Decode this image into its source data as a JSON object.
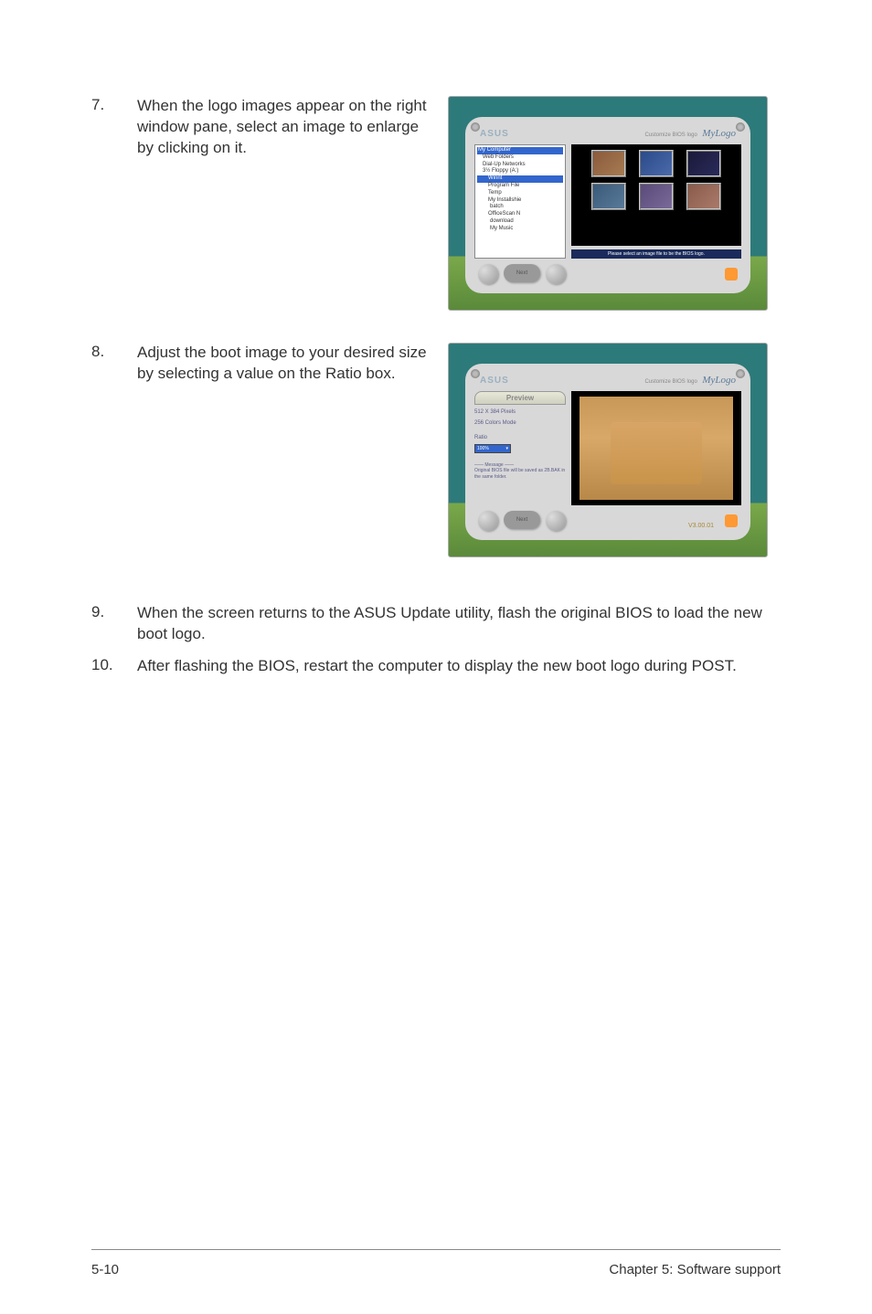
{
  "steps": {
    "s7": {
      "num": "7.",
      "text": "When the logo images appear on the right window pane, select an image to enlarge by clicking on it."
    },
    "s8": {
      "num": "8.",
      "text": "Adjust the boot image to your desired size by selecting a value on the Ratio box."
    },
    "s9": {
      "num": "9.",
      "text": "When the screen returns to the ASUS Update utility, flash the original BIOS to load the new boot logo."
    },
    "s10": {
      "num": "10.",
      "text": "After flashing the BIOS, restart the computer to display the new boot logo during POST."
    }
  },
  "screenshot1": {
    "brand": "ASUS",
    "customize": "Customize BIOS logo",
    "mylogo": "MyLogo",
    "tree": {
      "root": "My Computer",
      "items": [
        "Web Folders",
        "Dial-Up Networks",
        "3½ Floppy (A:)",
        "Winnt",
        "Program File",
        "Temp",
        "My Installshie",
        "batch",
        "OfficeScan N",
        "download",
        "My Music"
      ]
    },
    "status": "Please select an image file to be the BIOS logo.",
    "next_btn": "Next"
  },
  "screenshot2": {
    "brand": "ASUS",
    "customize": "Customize BIOS logo",
    "mylogo": "MyLogo",
    "preview_tab": "Preview",
    "pixels": "512 X 384 Pixels",
    "colors": "256 Colors Mode",
    "ratio_label": "Ratio",
    "ratio_value": "100%",
    "message_header": "Message",
    "message": "Original BIOS file will be saved as 2B.BAK in the same folder.",
    "next_btn": "Next",
    "version": "V3.00.01"
  },
  "footer": {
    "left": "5-10",
    "right": "Chapter 5: Software support"
  }
}
